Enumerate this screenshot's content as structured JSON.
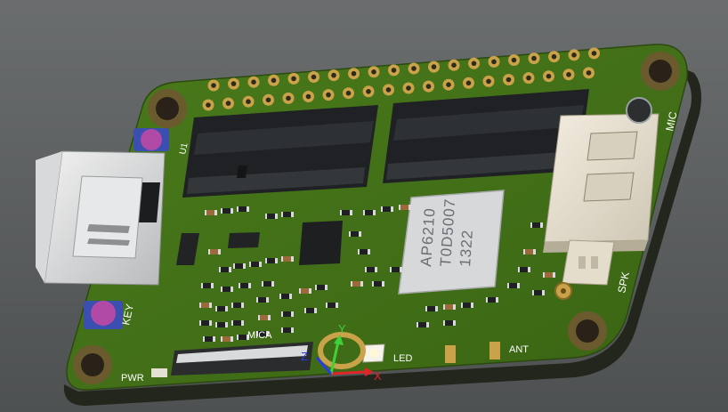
{
  "scene": {
    "background_color": "#5a5d5e",
    "board_color": "#3f6a17",
    "board_edge_color": "#2a2f20"
  },
  "silkscreen": {
    "mic": "MIC",
    "spk": "SPK",
    "key": "KEY",
    "pwr": "PWR",
    "mica": "MICA",
    "led": "LED",
    "ant": "ANT",
    "u1": "U1"
  },
  "chip": {
    "line1": "AP6210",
    "line2": "T0D5007",
    "line3": "1322"
  },
  "axes": {
    "x_label": "X",
    "y_label": "Y",
    "z_label": "Z",
    "x_color": "#e0262b",
    "y_color": "#3fd13a",
    "z_color": "#2b3de0"
  }
}
